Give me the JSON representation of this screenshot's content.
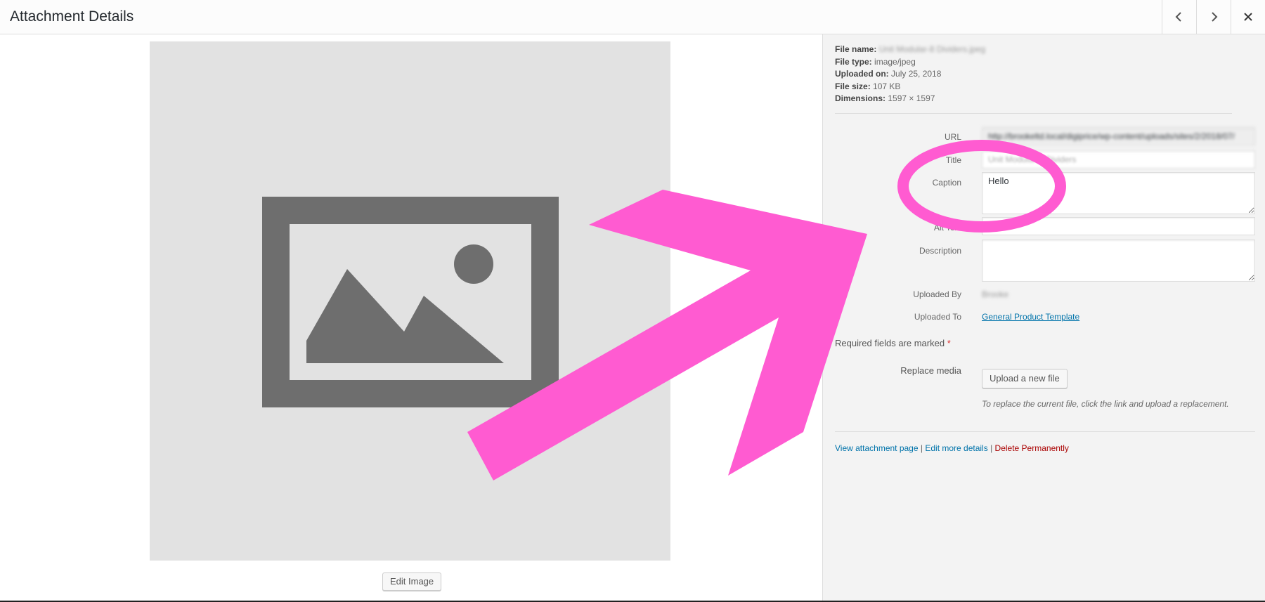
{
  "header": {
    "title": "Attachment Details",
    "prev_icon": "chevron-left-icon",
    "next_icon": "chevron-right-icon",
    "close_icon": "close-icon"
  },
  "media": {
    "placeholder_icon": "image-placeholder-icon",
    "edit_image_label": "Edit Image"
  },
  "file_info": {
    "file_name_label": "File name:",
    "file_name_value": "Unit Modular-8 Dividers.jpeg",
    "file_type_label": "File type:",
    "file_type_value": "image/jpeg",
    "uploaded_on_label": "Uploaded on:",
    "uploaded_on_value": "July 25, 2018",
    "file_size_label": "File size:",
    "file_size_value": "107 KB",
    "dimensions_label": "Dimensions:",
    "dimensions_value": "1597 × 1597"
  },
  "fields": {
    "url_label": "URL",
    "url_value": "http://brookeltd.local/digiprice/wp-content/uploads/sites/2/2018/07/",
    "title_label": "Title",
    "title_value": "Unit Modular-8 Dividers",
    "caption_label": "Caption",
    "caption_value": "Hello",
    "alt_label": "Alt Text",
    "alt_value": "",
    "description_label": "Description",
    "description_value": "",
    "uploaded_by_label": "Uploaded By",
    "uploaded_by_value": "Brooke",
    "uploaded_to_label": "Uploaded To",
    "uploaded_to_value": "General Product Template"
  },
  "required_note": "Required fields are marked",
  "required_star": "*",
  "replace": {
    "label": "Replace media",
    "button": "Upload a new file",
    "note": "To replace the current file, click the link and upload a replacement."
  },
  "actions": {
    "view": "View attachment page",
    "edit": "Edit more details",
    "delete": "Delete Permanently",
    "sep": "|"
  },
  "annotation": {
    "color": "#ff5bd1",
    "arrow_icon": "arrow-annotation-icon",
    "circle_icon": "circle-annotation-icon"
  }
}
